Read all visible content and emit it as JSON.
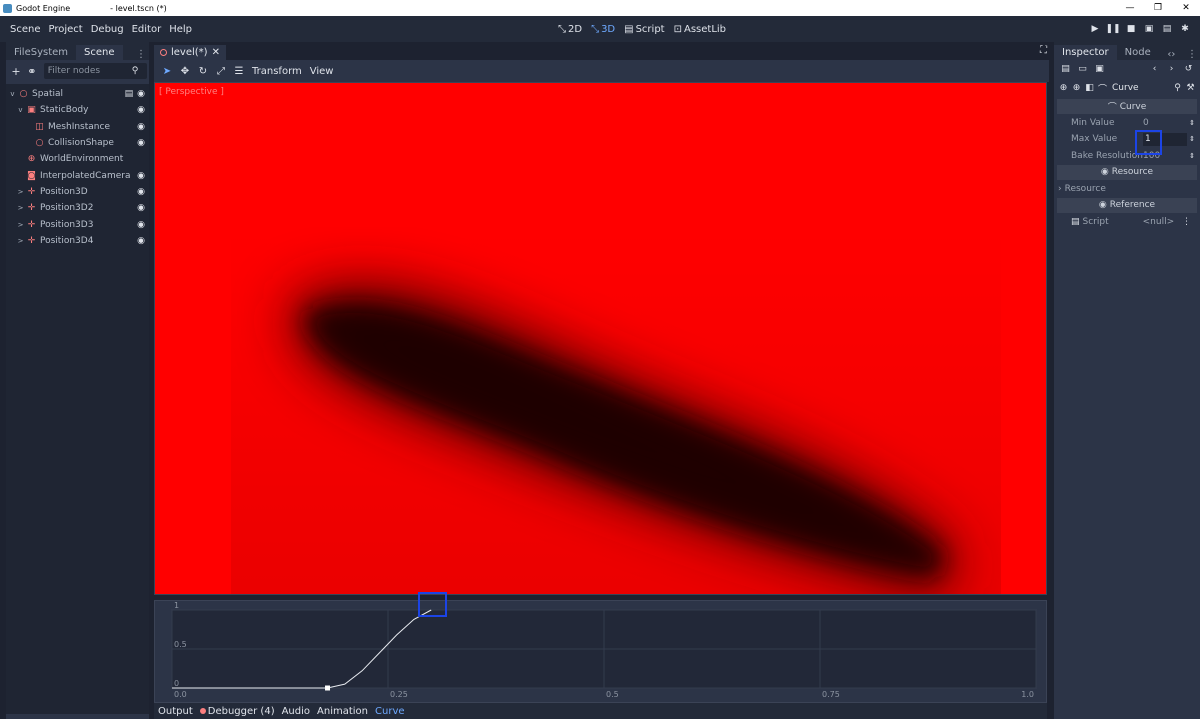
{
  "titlebar": {
    "app": "Godot Engine",
    "file": "- level.tscn (*)",
    "controls": [
      "—",
      "❐",
      "✕"
    ]
  },
  "menubar": {
    "items": [
      "Scene",
      "Project",
      "Debug",
      "Editor",
      "Help"
    ],
    "modes": [
      {
        "icon": "2d-icon",
        "glyph": "⤡",
        "label": "2D"
      },
      {
        "icon": "3d-icon",
        "glyph": "⤡",
        "label": "3D"
      },
      {
        "icon": "script-icon",
        "glyph": "▤",
        "label": "Script"
      },
      {
        "icon": "assetlib-icon",
        "glyph": "⊡",
        "label": "AssetLib"
      }
    ],
    "active_mode": "3D"
  },
  "left_dock": {
    "tabs": [
      "FileSystem",
      "Scene"
    ],
    "active_tab": "Scene",
    "filter_placeholder": "Filter nodes",
    "tree": [
      {
        "label": "Spatial",
        "depth": 0,
        "expand": "v",
        "icon": "spatial-icon",
        "glyph": "○",
        "icons": [
          "script-icon",
          "eye-icon"
        ]
      },
      {
        "label": "StaticBody",
        "depth": 1,
        "expand": "v",
        "icon": "staticbody-icon",
        "glyph": "▣",
        "icons": [
          "eye-icon"
        ]
      },
      {
        "label": "MeshInstance",
        "depth": 2,
        "expand": "",
        "icon": "meshinstance-icon",
        "glyph": "◫",
        "icons": [
          "eye-icon"
        ]
      },
      {
        "label": "CollisionShape",
        "depth": 2,
        "expand": "",
        "icon": "collisionshape-icon",
        "glyph": "○",
        "icons": [
          "eye-icon"
        ]
      },
      {
        "label": "WorldEnvironment",
        "depth": 1,
        "expand": "",
        "icon": "worldenvironment-icon",
        "glyph": "⊕",
        "icons": []
      },
      {
        "label": "InterpolatedCamera",
        "depth": 1,
        "expand": "",
        "icon": "camera-icon",
        "glyph": "◙",
        "icons": [
          "eye-icon"
        ]
      },
      {
        "label": "Position3D",
        "depth": 1,
        "expand": ">",
        "icon": "position3d-icon",
        "glyph": "✛",
        "icons": [
          "eye-icon"
        ]
      },
      {
        "label": "Position3D2",
        "depth": 1,
        "expand": ">",
        "icon": "position3d-icon",
        "glyph": "✛",
        "icons": [
          "eye-icon"
        ]
      },
      {
        "label": "Position3D3",
        "depth": 1,
        "expand": ">",
        "icon": "position3d-icon",
        "glyph": "✛",
        "icons": [
          "eye-icon"
        ]
      },
      {
        "label": "Position3D4",
        "depth": 1,
        "expand": ">",
        "icon": "position3d-icon",
        "glyph": "✛",
        "icons": [
          "eye-icon"
        ]
      }
    ]
  },
  "editor": {
    "scene_tab": "level(*)",
    "viewport_menus": [
      "Transform",
      "View"
    ],
    "viewport_label": "[ Perspective ]",
    "bottom_tabs": [
      "Output",
      "Debugger (4)",
      "Audio",
      "Animation",
      "Curve"
    ],
    "active_bottom_tab": "Curve"
  },
  "curve_editor": {
    "y_ticks": [
      "1",
      "0.5",
      "0"
    ],
    "x_ticks": [
      "0.0",
      "0.25",
      "0.5",
      "0.75",
      "1.0"
    ]
  },
  "chart_data": {
    "type": "line",
    "title": "",
    "xlabel": "",
    "ylabel": "",
    "xlim": [
      0,
      1
    ],
    "ylim": [
      0,
      1
    ],
    "series": [
      {
        "x": [
          0.0,
          0.18,
          0.2,
          0.22,
          0.24,
          0.26,
          0.28,
          0.3
        ],
        "values": [
          0,
          0,
          0.05,
          0.22,
          0.45,
          0.68,
          0.88,
          1.0
        ]
      }
    ],
    "control_point": {
      "x": 0.18,
      "y": 0
    }
  },
  "inspector": {
    "tabs": [
      "Inspector",
      "Node"
    ],
    "active_tab": "Inspector",
    "object_name": "Curve",
    "sections": {
      "curve_header": "Curve",
      "resource_header": "Resource",
      "reference_header": "Reference",
      "sub_resource": "Resource"
    },
    "properties": [
      {
        "label": "Min Value",
        "value": "0"
      },
      {
        "label": "Max Value",
        "value": "1"
      },
      {
        "label": "Bake Resolution",
        "value": "100"
      }
    ],
    "script": {
      "label": "Script",
      "value": "<null>"
    }
  },
  "colors": {
    "accent": "#6ea9ff",
    "viewport_bg": "#ff0000",
    "highlight": "#1c44e6",
    "panel": "#2c3447",
    "background": "#1d2230"
  }
}
